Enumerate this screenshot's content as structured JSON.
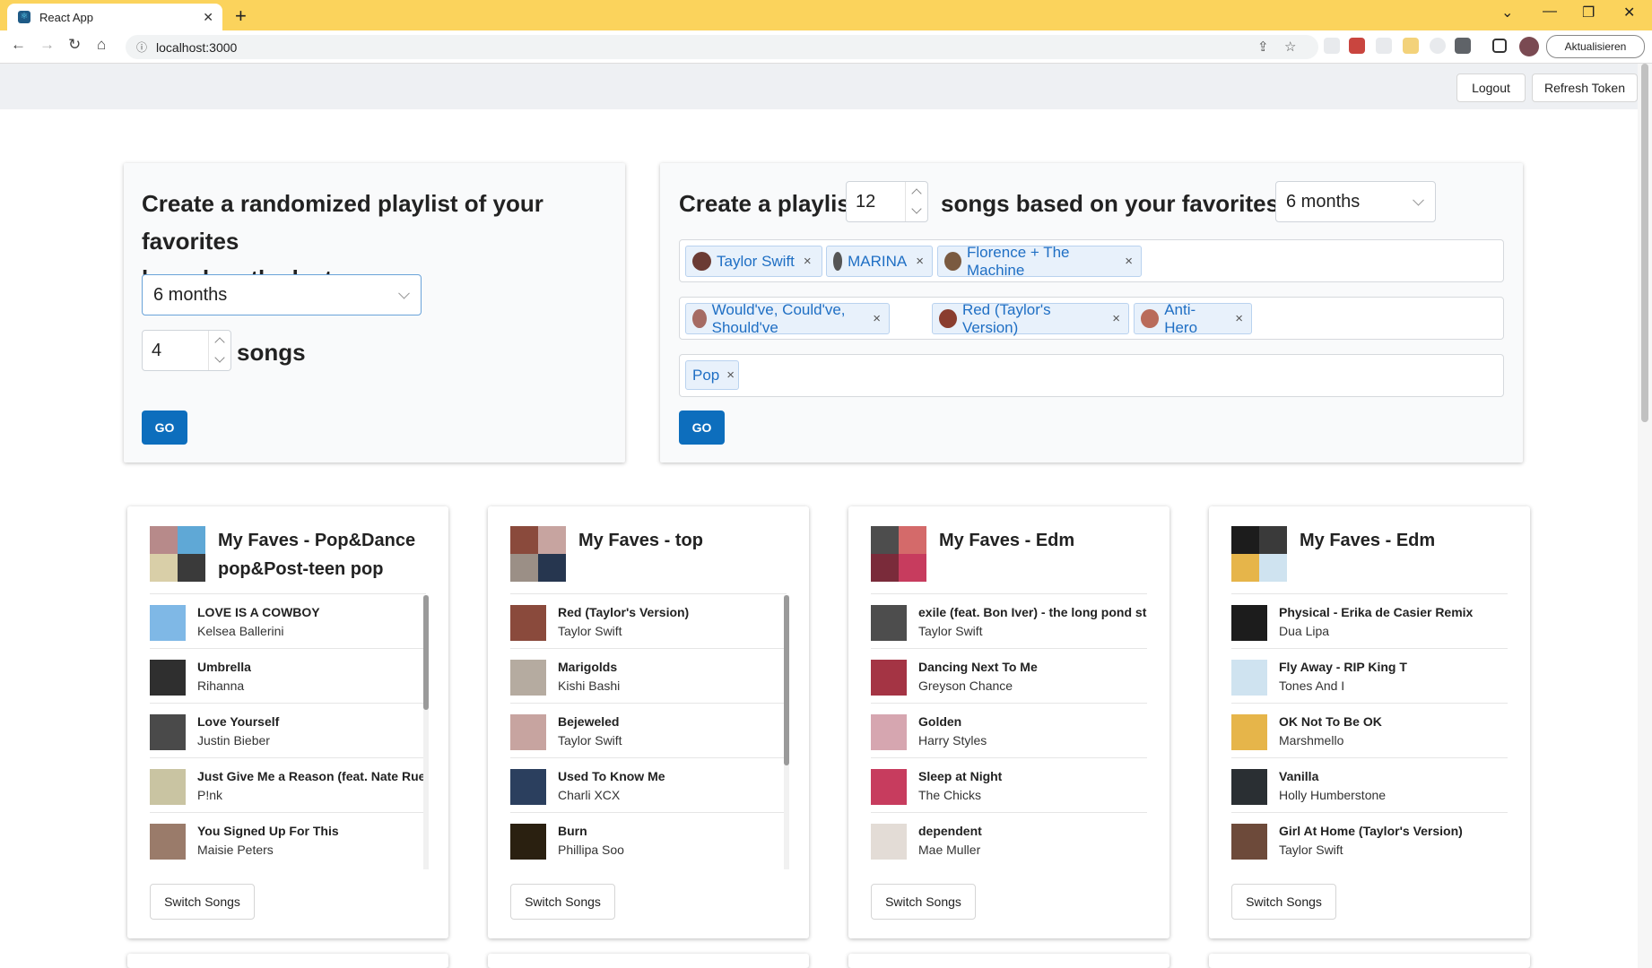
{
  "browser": {
    "tab_title": "React App",
    "tab_close": "✕",
    "new_tab": "+",
    "url": "localhost:3000",
    "update_label": "Aktualisieren"
  },
  "header": {
    "logout": "Logout",
    "refresh": "Refresh Token"
  },
  "random_form": {
    "heading_line1": "Create a randomized playlist of your favorites",
    "heading_line2": "based on the last",
    "period": "6 months",
    "count": "4",
    "songs_label": "songs",
    "go": "GO"
  },
  "seed_form": {
    "heading_prefix": "Create a playlist",
    "count": "12",
    "heading_middle": "songs based on your favorites for",
    "period": "6 months",
    "artists": [
      "Taylor Swift",
      "MARINA",
      "Florence + The Machine"
    ],
    "tracks": [
      "Would've, Could've, Should've",
      "Red (Taylor's Version)",
      "Anti-Hero"
    ],
    "genres": [
      "Pop"
    ],
    "remove_icon": "×",
    "go": "GO"
  },
  "playlists": [
    {
      "title": "My Faves - Pop&Dance pop&Post-teen pop",
      "songs": [
        {
          "title": "LOVE IS A COWBOY",
          "artist": "Kelsea Ballerini"
        },
        {
          "title": "Umbrella",
          "artist": "Rihanna"
        },
        {
          "title": "Love Yourself",
          "artist": "Justin Bieber"
        },
        {
          "title": "Just Give Me a Reason (feat. Nate Ruess)",
          "artist": "P!nk"
        },
        {
          "title": "You Signed Up For This",
          "artist": "Maisie Peters"
        }
      ],
      "switch": "Switch Songs"
    },
    {
      "title": "My Faves - top",
      "songs": [
        {
          "title": "Red (Taylor's Version)",
          "artist": "Taylor Swift"
        },
        {
          "title": "Marigolds",
          "artist": "Kishi Bashi"
        },
        {
          "title": "Bejeweled",
          "artist": "Taylor Swift"
        },
        {
          "title": "Used To Know Me",
          "artist": "Charli XCX"
        },
        {
          "title": "Burn",
          "artist": "Phillipa Soo"
        }
      ],
      "switch": "Switch Songs"
    },
    {
      "title": "My Faves - Edm",
      "songs": [
        {
          "title": "exile (feat. Bon Iver) - the long pond studio",
          "artist": "Taylor Swift"
        },
        {
          "title": "Dancing Next To Me",
          "artist": "Greyson Chance"
        },
        {
          "title": "Golden",
          "artist": "Harry Styles"
        },
        {
          "title": "Sleep at Night",
          "artist": "The Chicks"
        },
        {
          "title": "dependent",
          "artist": "Mae Muller"
        }
      ],
      "switch": "Switch Songs"
    },
    {
      "title": "My Faves - Edm",
      "songs": [
        {
          "title": "Physical - Erika de Casier Remix",
          "artist": "Dua Lipa"
        },
        {
          "title": "Fly Away - RIP King T",
          "artist": "Tones And I"
        },
        {
          "title": "OK Not To Be OK",
          "artist": "Marshmello"
        },
        {
          "title": "Vanilla",
          "artist": "Holly Humberstone"
        },
        {
          "title": "Girl At Home (Taylor's Version)",
          "artist": "Taylor Swift"
        }
      ],
      "switch": "Switch Songs"
    }
  ],
  "colors": {
    "tabbar": "#fbd35c",
    "primary": "#0d6ebd",
    "tag_text": "#1f6fc4"
  }
}
